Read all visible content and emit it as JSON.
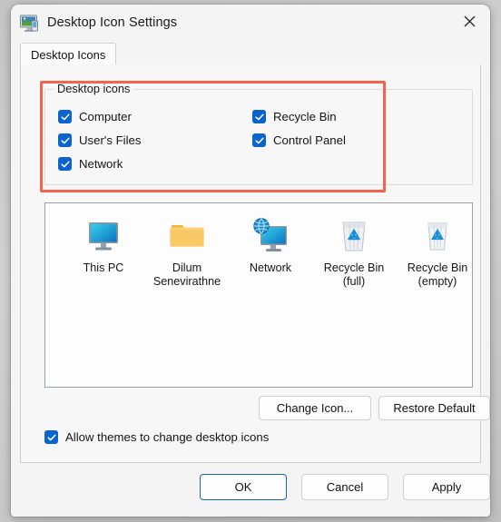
{
  "window": {
    "title": "Desktop Icon Settings",
    "icon": "monitor-icon",
    "close_label": "close-icon"
  },
  "tabs": [
    {
      "label": "Desktop Icons",
      "selected": true
    }
  ],
  "group": {
    "legend": "Desktop icons",
    "checkboxes": [
      {
        "label": "Computer",
        "checked": true,
        "column": "left"
      },
      {
        "label": "User's Files",
        "checked": true,
        "column": "left"
      },
      {
        "label": "Network",
        "checked": true,
        "column": "left"
      },
      {
        "label": "Recycle Bin",
        "checked": true,
        "column": "right"
      },
      {
        "label": "Control Panel",
        "checked": true,
        "column": "right"
      }
    ]
  },
  "annotation": {
    "type": "highlight-rectangle",
    "color": "#f4634f",
    "targets": "Desktop icons checkbox group"
  },
  "preview": {
    "icons": [
      {
        "caption": "This PC",
        "art": "monitor-icon"
      },
      {
        "caption": "Dilum Senevirathne",
        "art": "folder-icon"
      },
      {
        "caption": "Network",
        "art": "network-globe-monitor-icon"
      },
      {
        "caption": "Recycle Bin (full)",
        "art": "recycle-bin-full-icon"
      },
      {
        "caption": "Recycle Bin (empty)",
        "art": "recycle-bin-empty-icon"
      }
    ]
  },
  "actions": {
    "change_icon": "Change Icon...",
    "restore_default": "Restore Default"
  },
  "allow_themes": {
    "label": "Allow themes to change desktop icons",
    "checked": true
  },
  "footer": {
    "ok": "OK",
    "cancel": "Cancel",
    "apply": "Apply"
  },
  "colors": {
    "accent": "#0b63ce",
    "annotation": "#f4634f",
    "focus_border": "#1565c0"
  }
}
